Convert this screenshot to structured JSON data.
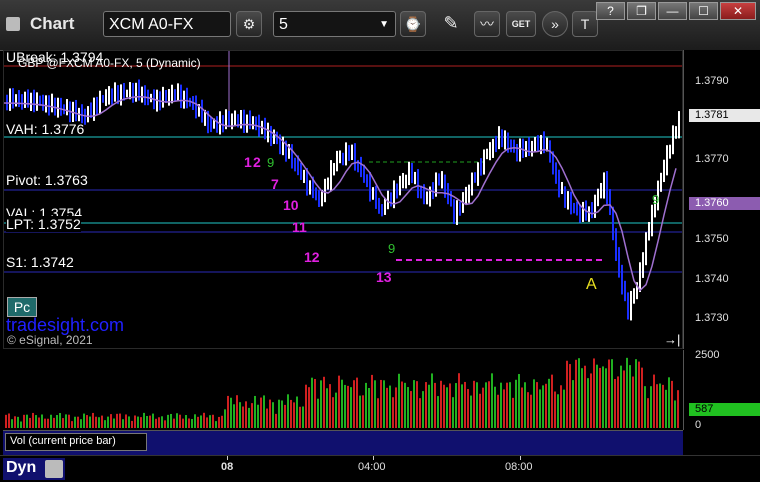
{
  "toolbar": {
    "title": "Chart",
    "symbol": "XCM A0-FX",
    "interval": "5",
    "icons": [
      "settings-icon",
      "clock-icon",
      "pencil-icon",
      "study-icon",
      "get-icon",
      "forward-icon",
      "text-icon"
    ]
  },
  "window_buttons": {
    "help": "?",
    "restore": "❐",
    "minimize": "—",
    "maximize": "☐",
    "close": "✕"
  },
  "chart": {
    "symbol_label": "GBP @FXCM A0-FX, 5 (Dynamic)",
    "ubreak_label": "UBreak: 1.3794",
    "vah_label": "VAH: 1.3776",
    "pivot_label": "Pivot: 1.3763",
    "val_label": "VAL: 1.3754",
    "lpt_label": "LPT: 1.3752",
    "s1_label": "S1: 1.3742",
    "watermark": "tradesight.com",
    "copyright": "© eSignal, 2021",
    "pc_badge": "Pc",
    "last_price": "1.3781",
    "ma_value": "1.3760",
    "marker_a": "A",
    "counts": [
      {
        "text": "1",
        "color": "#e020e0"
      },
      {
        "text": "2",
        "color": "#e020e0"
      },
      {
        "text": "7",
        "color": "#e020e0"
      },
      {
        "text": "10",
        "color": "#e020e0"
      },
      {
        "text": "11",
        "color": "#e020e0"
      },
      {
        "text": "12",
        "color": "#e020e0"
      },
      {
        "text": "13",
        "color": "#e020e0"
      }
    ],
    "green_counts": [
      "9",
      "9",
      "9"
    ]
  },
  "price_axis": [
    "1.3790",
    "1.3780",
    "1.3770",
    "1.3750",
    "1.3740",
    "1.3730"
  ],
  "volume": {
    "panel_label": "Vol (current price bar)",
    "axis": [
      "2500",
      "0"
    ],
    "current": "587"
  },
  "time_axis": [
    "08",
    "04:00",
    "08:00"
  ],
  "footer": {
    "dyn": "Dyn"
  },
  "colors": {
    "bull_bar": "#ffffff",
    "bear_bar": "#1a2fff",
    "ma": "#a070d0",
    "vah": "#20c8c8",
    "level": "#2020b0",
    "ubreak": "#c02020",
    "target": "#e020e0"
  }
}
